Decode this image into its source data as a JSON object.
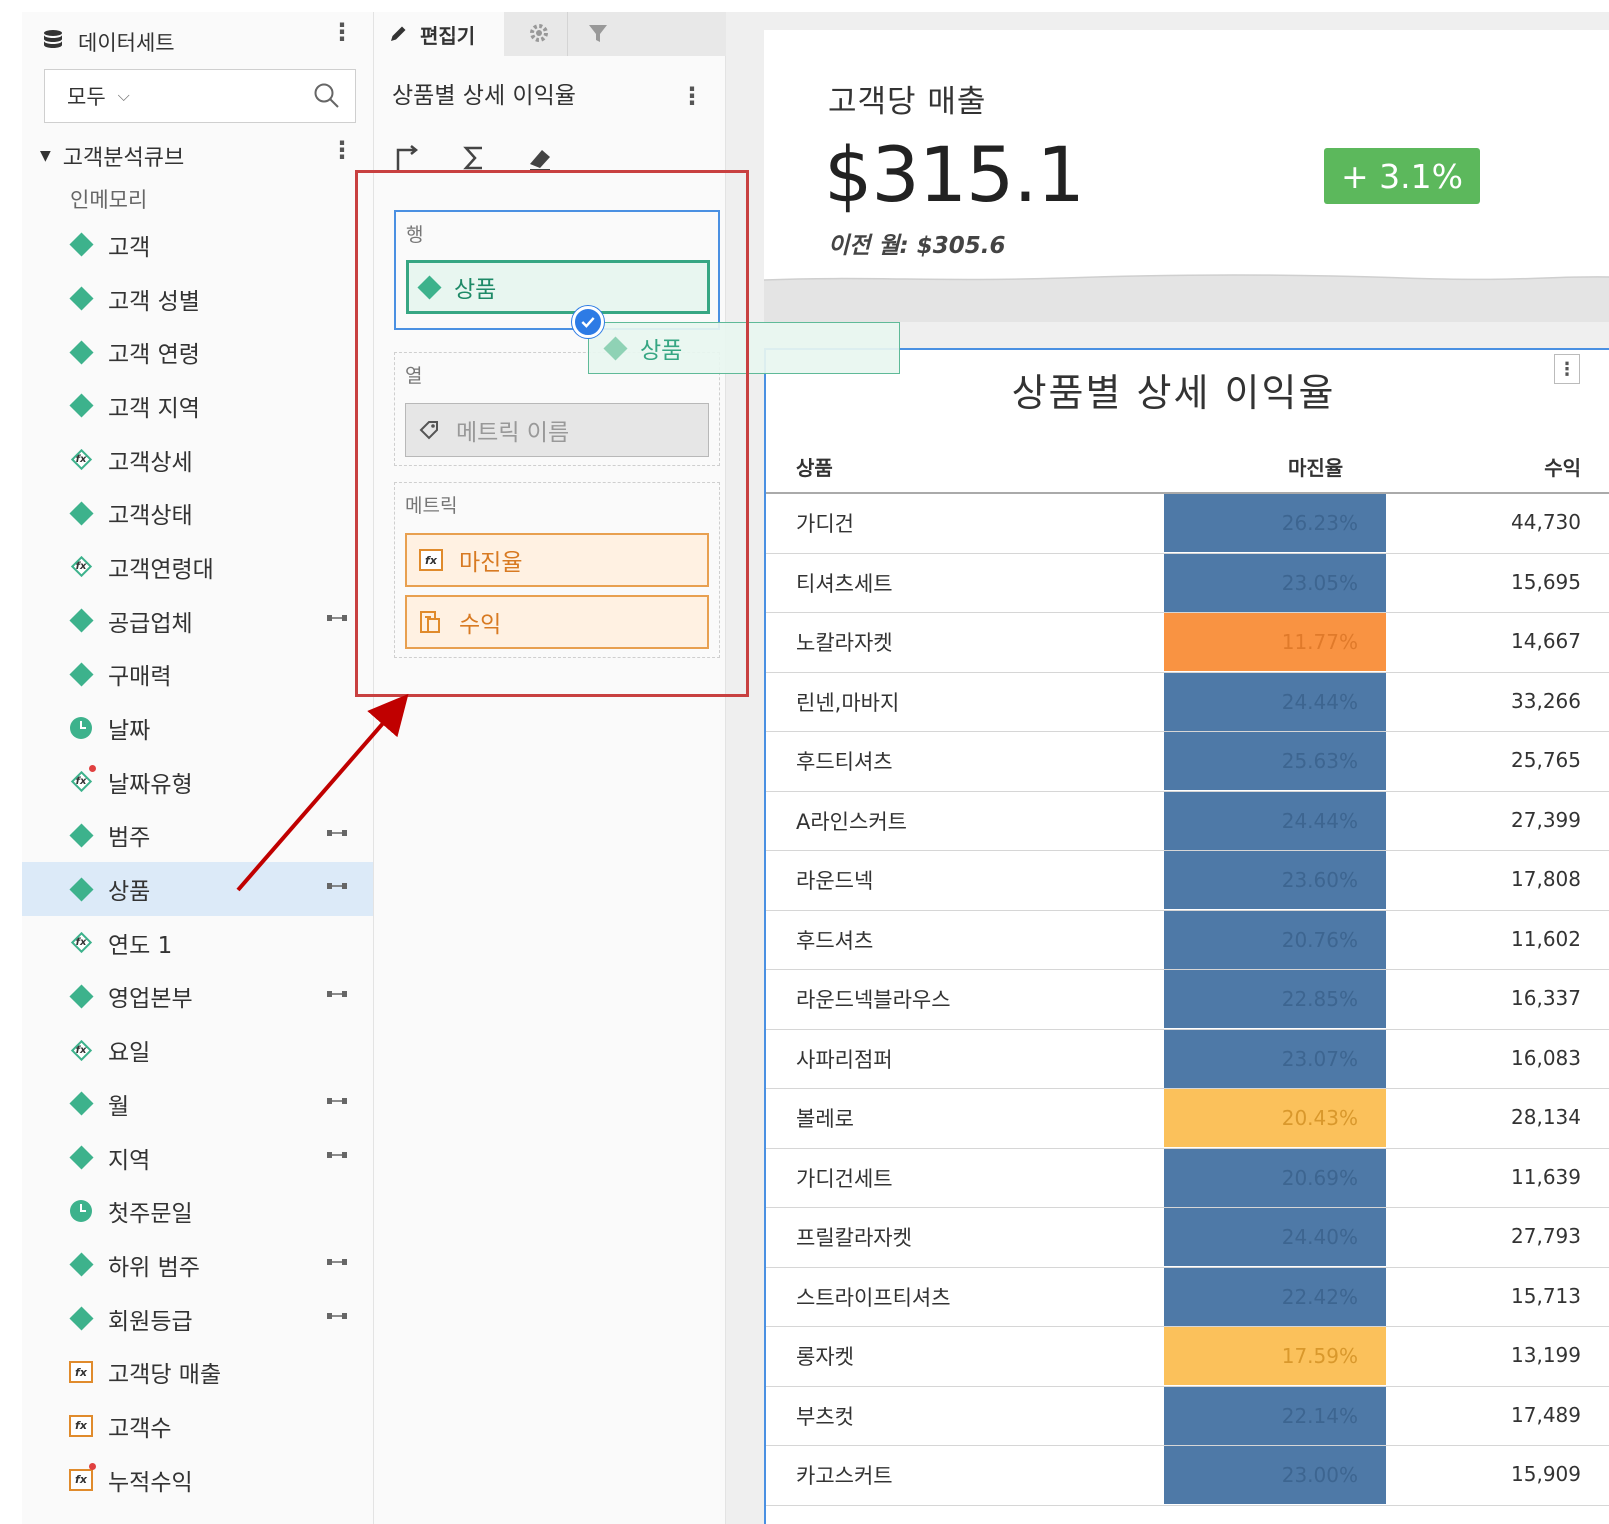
{
  "dataset_panel": {
    "header": "데이터세트",
    "filter_value": "모두",
    "cube_name": "고객분석큐브",
    "cube_sub": "인메모리",
    "fields": [
      {
        "label": "고객",
        "icon": "dimension-icon",
        "hier": false
      },
      {
        "label": "고객 성별",
        "icon": "dimension-icon",
        "hier": false
      },
      {
        "label": "고객 연령",
        "icon": "dimension-icon",
        "hier": false
      },
      {
        "label": "고객 지역",
        "icon": "dimension-icon",
        "hier": false
      },
      {
        "label": "고객상세",
        "icon": "calc-dimension-icon",
        "hier": false
      },
      {
        "label": "고객상태",
        "icon": "dimension-icon",
        "hier": false
      },
      {
        "label": "고객연령대",
        "icon": "calc-dimension-icon",
        "hier": false
      },
      {
        "label": "공급업체",
        "icon": "dimension-icon",
        "hier": true
      },
      {
        "label": "구매력",
        "icon": "dimension-icon",
        "hier": false
      },
      {
        "label": "날짜",
        "icon": "date-icon",
        "hier": false
      },
      {
        "label": "날짜유형",
        "icon": "calc-dimension-alert-icon",
        "hier": false
      },
      {
        "label": "범주",
        "icon": "dimension-icon",
        "hier": true
      },
      {
        "label": "상품",
        "icon": "dimension-icon",
        "hier": true,
        "selected": true
      },
      {
        "label": "연도 1",
        "icon": "calc-dimension-icon",
        "hier": false
      },
      {
        "label": "영업본부",
        "icon": "dimension-icon",
        "hier": true
      },
      {
        "label": "요일",
        "icon": "calc-dimension-icon",
        "hier": false
      },
      {
        "label": "월",
        "icon": "dimension-icon",
        "hier": true
      },
      {
        "label": "지역",
        "icon": "dimension-icon",
        "hier": true
      },
      {
        "label": "첫주문일",
        "icon": "date-icon",
        "hier": false
      },
      {
        "label": "하위 범주",
        "icon": "dimension-icon",
        "hier": true
      },
      {
        "label": "회원등급",
        "icon": "dimension-icon",
        "hier": true
      },
      {
        "label": "고객당 매출",
        "icon": "calc-metric-icon",
        "hier": false
      },
      {
        "label": "고객수",
        "icon": "calc-metric-icon",
        "hier": false
      },
      {
        "label": "누적수익",
        "icon": "calc-metric-alert-icon",
        "hier": false
      }
    ]
  },
  "editor_panel": {
    "tab_label": "편집기",
    "title": "상품별 상세 이익율",
    "rows_label": "행",
    "rows_pill": "상품",
    "columns_label": "열",
    "columns_pill": "메트릭 이름",
    "metrics_label": "메트릭",
    "metric_pills": [
      "마진율",
      "수익"
    ],
    "drag_ghost_label": "상품"
  },
  "kpi": {
    "title": "고객당 매출",
    "value": "$315.1",
    "change": "+ 3.1%",
    "previous": "이전 월: $305.6",
    "change_color": "#5cb85c"
  },
  "table": {
    "title": "상품별 상세 이익율",
    "headers": [
      "상품",
      "마진율",
      "수익"
    ],
    "rows": [
      {
        "product": "가디건",
        "margin": "26.23%",
        "revenue": "44,730",
        "color": "blue"
      },
      {
        "product": "티셔츠세트",
        "margin": "23.05%",
        "revenue": "15,695",
        "color": "blue"
      },
      {
        "product": "노칼라자켓",
        "margin": "11.77%",
        "revenue": "14,667",
        "color": "orange"
      },
      {
        "product": "린넨,마바지",
        "margin": "24.44%",
        "revenue": "33,266",
        "color": "blue"
      },
      {
        "product": "후드티셔츠",
        "margin": "25.63%",
        "revenue": "25,765",
        "color": "blue"
      },
      {
        "product": "A라인스커트",
        "margin": "24.44%",
        "revenue": "27,399",
        "color": "blue"
      },
      {
        "product": "라운드넥",
        "margin": "23.60%",
        "revenue": "17,808",
        "color": "blue"
      },
      {
        "product": "후드셔츠",
        "margin": "20.76%",
        "revenue": "11,602",
        "color": "blue"
      },
      {
        "product": "라운드넥블라우스",
        "margin": "22.85%",
        "revenue": "16,337",
        "color": "blue"
      },
      {
        "product": "사파리점퍼",
        "margin": "23.07%",
        "revenue": "16,083",
        "color": "blue"
      },
      {
        "product": "볼레로",
        "margin": "20.43%",
        "revenue": "28,134",
        "color": "yellow"
      },
      {
        "product": "가디건세트",
        "margin": "20.69%",
        "revenue": "11,639",
        "color": "blue"
      },
      {
        "product": "프릴칼라자켓",
        "margin": "24.40%",
        "revenue": "27,793",
        "color": "blue"
      },
      {
        "product": "스트라이프티셔츠",
        "margin": "22.42%",
        "revenue": "15,713",
        "color": "blue"
      },
      {
        "product": "롱자켓",
        "margin": "17.59%",
        "revenue": "13,199",
        "color": "yellow"
      },
      {
        "product": "부츠컷",
        "margin": "22.14%",
        "revenue": "17,489",
        "color": "blue"
      },
      {
        "product": "카고스커트",
        "margin": "23.00%",
        "revenue": "15,909",
        "color": "blue"
      }
    ],
    "cell_colors": {
      "blue": "#4e79a7",
      "orange": "#f99342",
      "yellow": "#fbc15b"
    }
  }
}
